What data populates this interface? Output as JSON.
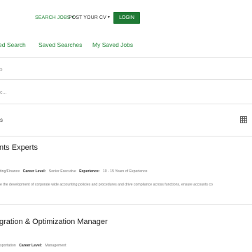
{
  "topnav": {
    "search_jobs": "SEARCH JOBS",
    "post_cv": "POST YOUR CV",
    "login": "LOGIN"
  },
  "tabs": [
    "ed Search",
    "Saved Searches",
    "My Saved Jobs"
  ],
  "filters": {
    "row1": "s",
    "row2": "c..."
  },
  "results_label": "s",
  "jobs": [
    {
      "title": "nts Experts",
      "sector_tail": "ting/Finance",
      "career_level_label": "Career Level:",
      "career_level": "Senior Executive",
      "experience_label": "Experience:",
      "experience": "10 - 15 Years of Experience",
      "description": "e the development of corporate wide accounting policies and procedures and drive compliance across functions, ensure accounts co"
    },
    {
      "title": "gration & Optimization Manager",
      "sector_tail": "sportation",
      "career_level_label": "Career Level:",
      "career_level": "Management"
    }
  ],
  "colors": {
    "brand_green": "#2a8a3e",
    "button_green": "#1f7a35"
  }
}
